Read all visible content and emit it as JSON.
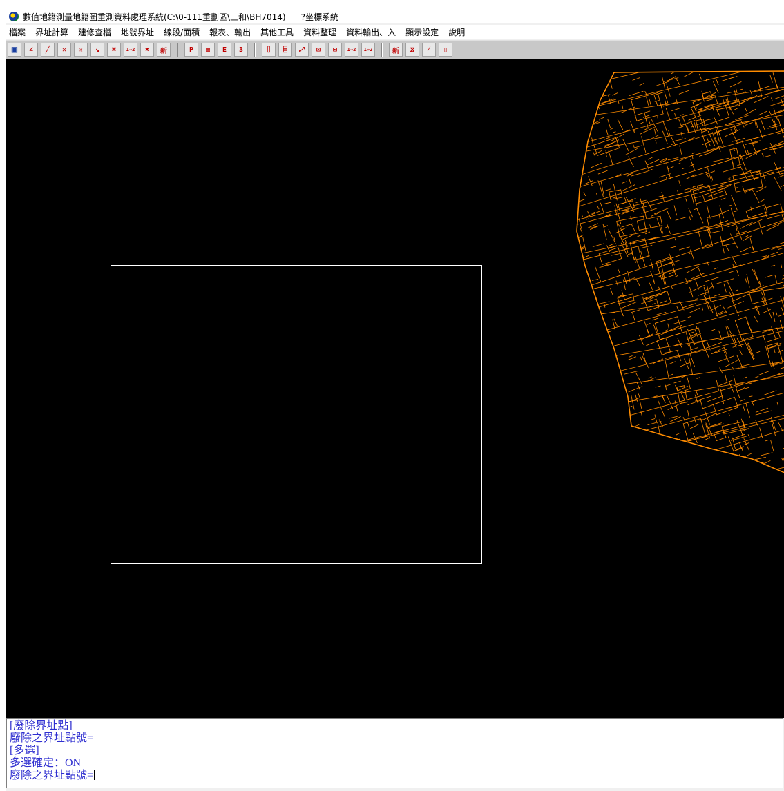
{
  "window": {
    "title": "數值地籍測量地籍圖重測資料處理系統(C:\\0-111重劃區\\三和\\BH7014)",
    "title_extra": "?坐標系統",
    "icon": "app-globe-icon"
  },
  "menu": [
    "檔案",
    "界址計算",
    "建修查檔",
    "地號界址",
    "線段/面積",
    "報表、輸出",
    "其他工具",
    "資料整理",
    "資料輸出、入",
    "顯示設定",
    "說明"
  ],
  "toolbar": {
    "buttons": [
      {
        "name": "save-icon",
        "glyph": "▣"
      },
      {
        "name": "angle-point-icon",
        "glyph": "∠"
      },
      {
        "name": "line-icon",
        "glyph": "╱"
      },
      {
        "name": "cross-line-icon",
        "glyph": "✕"
      },
      {
        "name": "multi-cross-icon",
        "glyph": "✳"
      },
      {
        "name": "snap-line-icon",
        "glyph": "↘"
      },
      {
        "name": "transform-icon",
        "glyph": "⌘"
      },
      {
        "name": "renumber-12-icon",
        "glyph": "1→2"
      },
      {
        "name": "delete-point-icon",
        "glyph": "✖"
      },
      {
        "name": "new-point-icon",
        "glyph": "新"
      },
      {
        "name": "p-report-icon",
        "glyph": "P"
      },
      {
        "name": "table-icon",
        "glyph": "▦"
      },
      {
        "name": "e-output-icon",
        "glyph": "E"
      },
      {
        "name": "number-3-icon",
        "glyph": "3"
      },
      {
        "name": "rect-left-icon",
        "glyph": "⌷"
      },
      {
        "name": "rect-corner-icon",
        "glyph": "⌸"
      },
      {
        "name": "diagonal-icon",
        "glyph": "⤢"
      },
      {
        "name": "box-x-icon",
        "glyph": "⊠"
      },
      {
        "name": "frame-icon",
        "glyph": "⊡"
      },
      {
        "name": "seq-12-icon",
        "glyph": "1→2"
      },
      {
        "name": "seq-12-cross-icon",
        "glyph": "1↔2"
      },
      {
        "name": "new-line-icon",
        "glyph": "新"
      },
      {
        "name": "hourglass-icon",
        "glyph": "⧖"
      },
      {
        "name": "slash-icon",
        "glyph": "⁄"
      },
      {
        "name": "bracket-icon",
        "glyph": "▯"
      }
    ],
    "separators_after": [
      9,
      13,
      20
    ]
  },
  "canvas": {
    "background": "#000000",
    "parcel_color": "#ff8c00",
    "selection_color": "#ffffff"
  },
  "console": {
    "lines": [
      "[廢除界址點]",
      "廢除之界址點號=",
      "[多選]",
      "多選確定：ON",
      "廢除之界址點號="
    ],
    "text_color": "#2f2fd0"
  }
}
